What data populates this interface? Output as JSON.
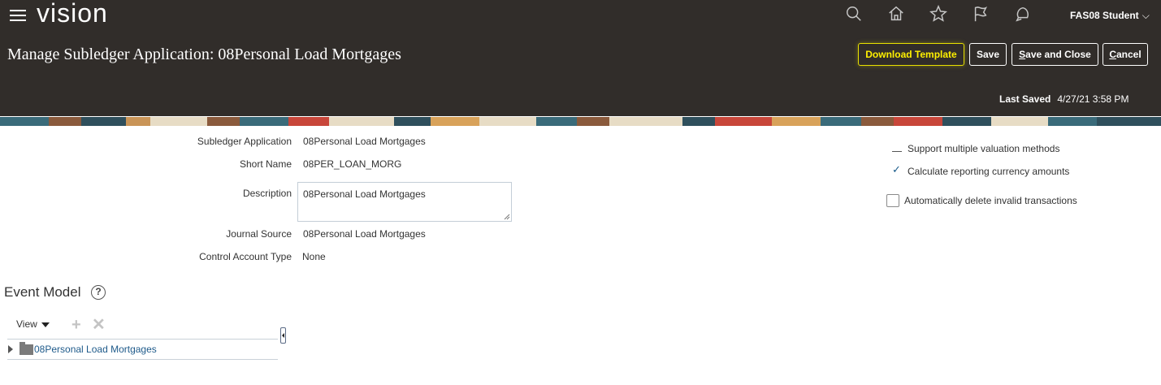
{
  "header": {
    "brand": "vision",
    "user_name": "FAS08 Student",
    "icons": [
      "search-icon",
      "home-icon",
      "star-icon",
      "flag-icon",
      "bell-icon"
    ]
  },
  "page": {
    "title": "Manage Subledger Application: 08Personal Load Mortgages",
    "buttons": {
      "download_template": "Download Template",
      "save": "Save",
      "save_and_close_accel": "S",
      "save_and_close_rest": "ave and Close",
      "cancel_accel": "C",
      "cancel_rest": "ancel"
    },
    "last_saved_label": "Last Saved",
    "last_saved_value": "4/27/21 3:58 PM"
  },
  "form": {
    "subledger_application_label": "Subledger Application",
    "subledger_application_value": "08Personal Load Mortgages",
    "short_name_label": "Short Name",
    "short_name_value": "08PER_LOAN_MORG",
    "description_label": "Description",
    "description_value": "08Personal Load Mortgages",
    "journal_source_label": "Journal Source",
    "journal_source_value": "08Personal Load Mortgages",
    "control_account_type_label": "Control Account Type",
    "control_account_type_value": "None"
  },
  "options": {
    "support_multiple_valuation": "Support multiple valuation methods",
    "calculate_reporting_currency": "Calculate reporting currency amounts",
    "auto_delete_invalid": "Automatically delete invalid transactions",
    "calculate_reporting_currency_checked": true,
    "auto_delete_invalid_checked": false
  },
  "event_model": {
    "title": "Event Model",
    "view_label": "View",
    "tree_items": [
      "08Personal Load Mortgages"
    ]
  },
  "colors": {
    "header_bg": "#312d2a",
    "accent_yellow": "#fff000",
    "link_blue": "#1e5a8a"
  }
}
